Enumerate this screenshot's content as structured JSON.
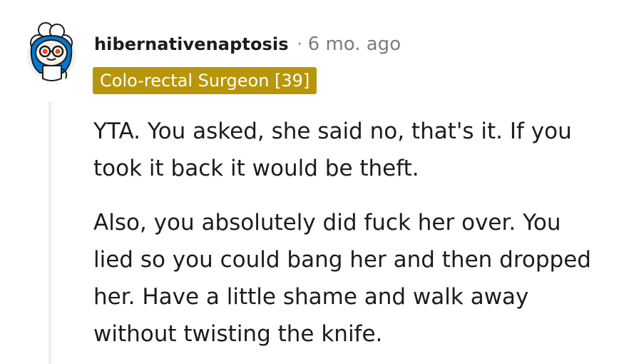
{
  "comment": {
    "username": "hibernativenaptosis",
    "separator": "·",
    "timestamp": "6 mo. ago",
    "flair": "Colo-rectal Surgeon [39]",
    "paragraphs": [
      "YTA. You asked, she said no, that's it. If you took it back it would be theft.",
      "Also, you absolutely did fuck her over. You lied so you could bang her and then dropped her. Have a little shame and walk away without twisting the knife."
    ]
  },
  "avatar": {
    "icon": "snoo-avatar-icon",
    "colors": {
      "hood": "#0079d3",
      "eyes": "#ff4500",
      "fur": "#ffffff",
      "skin": "#f4f1ea"
    }
  },
  "colors": {
    "flair_bg": "#b8960b",
    "meta_text": "#7c7c7c",
    "thread_line": "#edeff1"
  }
}
